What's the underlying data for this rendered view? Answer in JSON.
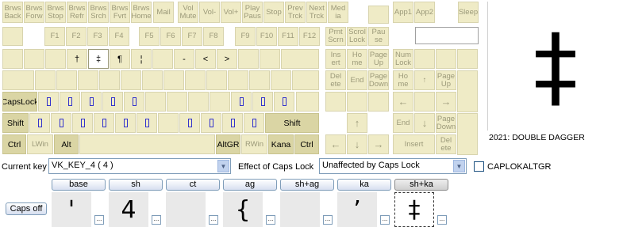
{
  "media_keys": [
    "Brws\nBack",
    "Brws\nForw",
    "Brws\nStop",
    "Brws\nRefr",
    "Brws\nSrch",
    "Brws\nFvrt",
    "Brws\nHome",
    "Mail",
    "Vol\nMute",
    "Vol-",
    "Vol+",
    "Play\nPaus",
    "Stop",
    "Prev\nTrck",
    "Next\nTrck",
    "Med\nia"
  ],
  "app_keys": [
    "App1",
    "App2",
    "Sleep"
  ],
  "fkeys": [
    "F1",
    "F2",
    "F3",
    "F4",
    "F5",
    "F6",
    "F7",
    "F8",
    "F9",
    "F10",
    "F11",
    "F12"
  ],
  "nav_top": [
    "Prnt\nScrn",
    "Scrol\nLock",
    "Pau\nse"
  ],
  "num_row_chars": [
    "†",
    "‡",
    "¶",
    "¦",
    "-",
    "<",
    ">"
  ],
  "nav_mid": [
    "Ins\nert",
    "Ho\nme",
    "Page\nUp",
    "Num\nLock"
  ],
  "nav_low": [
    "Del\nete",
    "End",
    "Page\nDown",
    "Ho\nme",
    "↑",
    "Page\nUp"
  ],
  "numpad_mid": [
    "←",
    "→"
  ],
  "numpad_low": [
    "End",
    "↓",
    "Page\nDown"
  ],
  "arrow_keys": [
    "↑",
    "←",
    "↓",
    "→",
    "Insert",
    "Del\nete"
  ],
  "mods": {
    "capslock": "CapsLock",
    "shift_l": "Shift",
    "shift_r": "Shift",
    "ctrl_l": "Ctrl",
    "lwin": "LWin",
    "alt": "Alt",
    "altgr": "AltGR",
    "rwin": "RWin",
    "kana": "Kana",
    "ctrl_r": "Ctrl"
  },
  "preview": {
    "glyph": "‡",
    "caption": "2021: DOUBLE DAGGER"
  },
  "current_key": {
    "label": "Current key",
    "value": "VK_KEY_4 ( 4 )"
  },
  "caps_effect": {
    "label": "Effect of Caps Lock",
    "value": "Unaffected by Caps Lock"
  },
  "caplokaltgr": {
    "label": "CAPLOKALTGR",
    "checked": false
  },
  "shift_tabs": [
    "base",
    "sh",
    "ct",
    "ag",
    "sh+ag",
    "ka",
    "sh+ka"
  ],
  "active_tab": 6,
  "caps_button": "Caps off",
  "shift_values": [
    "'",
    "4",
    "",
    "{",
    "",
    "ʼ",
    "‡"
  ],
  "mini_button": "..."
}
